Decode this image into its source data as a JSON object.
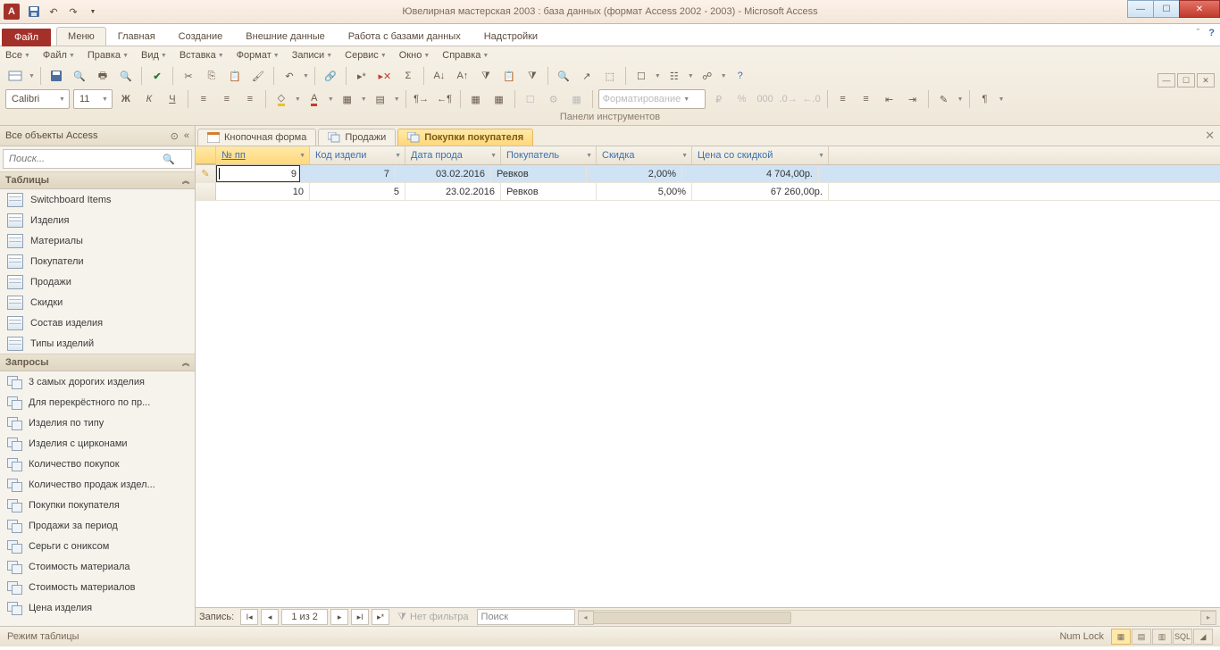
{
  "title": "Ювелирная мастерская 2003 : база данных (формат Access 2002 - 2003)  -  Microsoft Access",
  "qat": {
    "save": "save",
    "undo": "undo",
    "redo": "redo"
  },
  "ribbon": {
    "file": "Файл",
    "tabs": [
      "Меню",
      "Главная",
      "Создание",
      "Внешние данные",
      "Работа с базами данных",
      "Надстройки"
    ],
    "active_tab": 0,
    "menus": [
      "Все",
      "Файл",
      "Правка",
      "Вид",
      "Вставка",
      "Формат",
      "Записи",
      "Сервис",
      "Окно",
      "Справка"
    ],
    "font": "Calibri",
    "font_size": "11",
    "formatting_label": "Форматирование",
    "caption": "Панели инструментов"
  },
  "nav": {
    "header": "Все объекты Access",
    "search_placeholder": "Поиск...",
    "groups": [
      {
        "title": "Таблицы",
        "type": "table",
        "items": [
          "Switchboard Items",
          "Изделия",
          "Материалы",
          "Покупатели",
          "Продажи",
          "Скидки",
          "Состав изделия",
          "Типы изделий"
        ]
      },
      {
        "title": "Запросы",
        "type": "query",
        "items": [
          "3 самых дорогих изделия",
          "Для перекрёстного по пр...",
          "Изделия по типу",
          "Изделия с цирконами",
          "Количество покупок",
          "Количество продаж издел...",
          "Покупки покупателя",
          "Продажи за период",
          "Серьги с ониксом",
          "Стоимость материала",
          "Стоимость материалов",
          "Цена изделия"
        ]
      }
    ]
  },
  "doctabs": [
    {
      "label": "Кнопочная форма",
      "icon": "form"
    },
    {
      "label": "Продажи",
      "icon": "query"
    },
    {
      "label": "Покупки покупателя",
      "icon": "query",
      "active": true
    }
  ],
  "grid": {
    "columns": [
      {
        "label": "№ пп",
        "cls": "c-no",
        "underline": true,
        "align": "r"
      },
      {
        "label": "Код издели",
        "cls": "c-kod",
        "align": "r"
      },
      {
        "label": "Дата прода",
        "cls": "c-data",
        "align": "r"
      },
      {
        "label": "Покупатель",
        "cls": "c-pok",
        "align": "l"
      },
      {
        "label": "Скидка",
        "cls": "c-sk",
        "align": "r"
      },
      {
        "label": "Цена со скидкой",
        "cls": "c-cena",
        "align": "r"
      }
    ],
    "rows": [
      {
        "sel": true,
        "edit": true,
        "cells": [
          "9",
          "7",
          "03.02.2016",
          "Ревков",
          "2,00%",
          "4 704,00р."
        ]
      },
      {
        "cells": [
          "10",
          "5",
          "23.02.2016",
          "Ревков",
          "5,00%",
          "67 260,00р."
        ]
      }
    ]
  },
  "recordnav": {
    "label": "Запись:",
    "pos": "1 из 2",
    "nofilter": "Нет фильтра",
    "search": "Поиск"
  },
  "status": {
    "mode": "Режим таблицы",
    "numlock": "Num Lock",
    "sql": "SQL"
  }
}
